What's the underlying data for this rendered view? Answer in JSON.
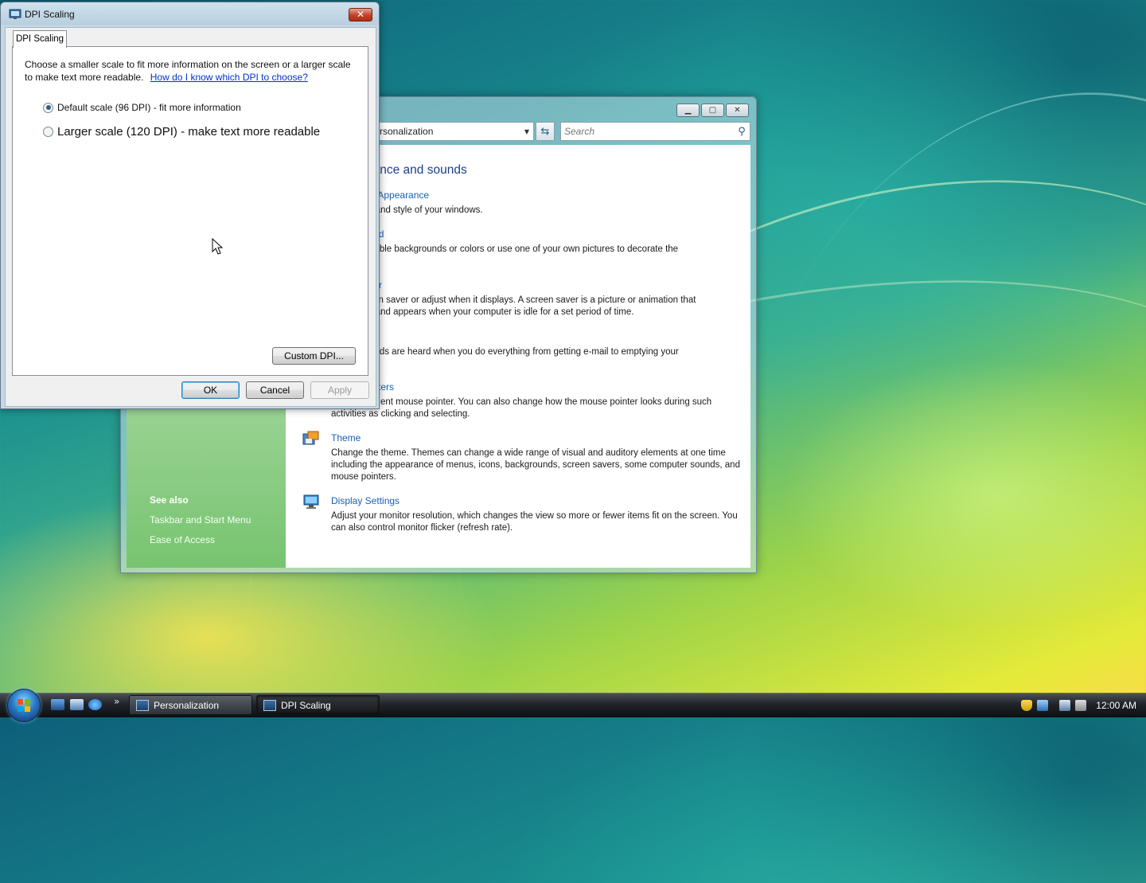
{
  "cp_window": {
    "address_text": "rsonalization",
    "search_placeholder": "Search",
    "heading": "ppearance and sounds",
    "tasks": [
      {
        "link": "lor and Appearance",
        "desc": "e color and style of your windows."
      },
      {
        "link": "ckground",
        "desc": "m available backgrounds or colors or use one of your own pictures to decorate the"
      },
      {
        "link": "r",
        "desc": "ur screen saver or adjust when it displays. A screen saver is a picture or animation that screen and appears when your computer is idle for a set period of time."
      },
      {
        "link": "",
        "desc": "ich sounds are heard when you do everything from getting e-mail to emptying your"
      },
      {
        "link": "ters",
        "desc": "ent mouse pointer. You can also change how the mouse pointer looks during such activities as clicking and selecting."
      },
      {
        "link": "Theme",
        "desc": "Change the theme. Themes can change a wide range of visual and auditory elements at one time including the appearance of menus, icons, backgrounds, screen savers, some computer sounds, and mouse pointers."
      },
      {
        "link": "Display Settings",
        "desc": "Adjust your monitor resolution, which changes the view so more or fewer items fit on the screen. You can also control monitor flicker (refresh rate)."
      }
    ],
    "see_also": {
      "label": "See also",
      "links": [
        "Taskbar and Start Menu",
        "Ease of Access"
      ]
    }
  },
  "dpi_dialog": {
    "title": "DPI Scaling",
    "tab": "DPI Scaling",
    "intro": "Choose a smaller scale to fit more information on the screen or a larger scale to make text more readable.",
    "help_link": "How do I know which DPI to choose?",
    "options": [
      {
        "label": "Default scale (96 DPI) - fit more information",
        "selected": true
      },
      {
        "label": "Larger scale (120 DPI) - make text more readable",
        "selected": false
      }
    ],
    "custom_button": "Custom DPI...",
    "ok_button": "OK",
    "cancel_button": "Cancel",
    "apply_button": "Apply"
  },
  "taskbar": {
    "buttons": [
      "Personalization",
      "DPI Scaling"
    ],
    "overflow": "»",
    "clock": "12:00 AM"
  },
  "colors": {
    "link": "#1a5fb4",
    "heading": "#1e3e8c",
    "close_button": "#c3402a"
  }
}
